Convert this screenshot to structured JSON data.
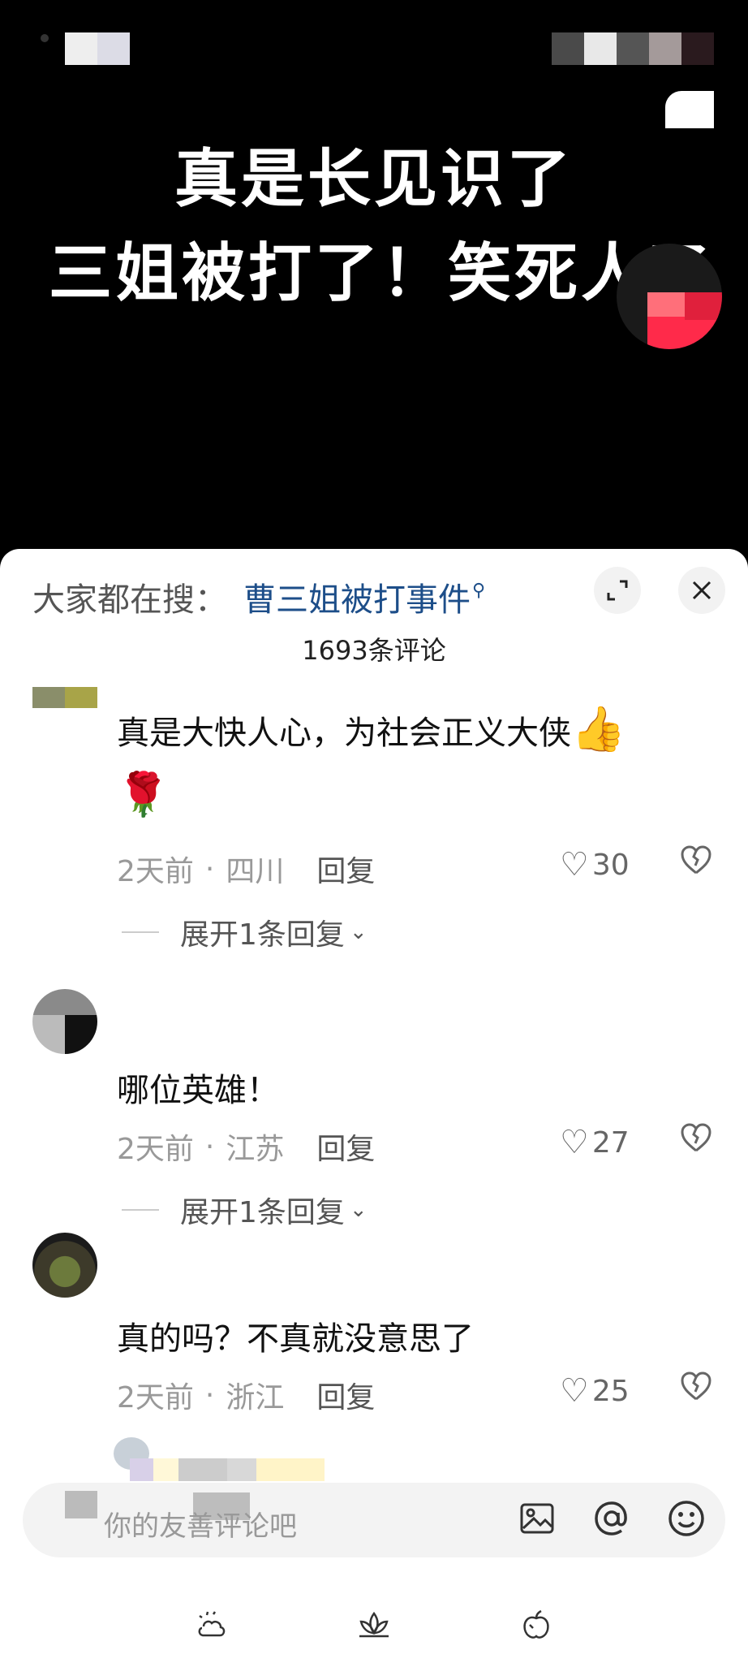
{
  "video": {
    "title_line1": "真是长见识了",
    "title_line2": "三姐被打了！笑死人了"
  },
  "sheet": {
    "search_prefix": "大家都在搜：",
    "search_query": "曹三姐被打事件",
    "comment_count": "1693条评论"
  },
  "comments": [
    {
      "text": "真是大快人心，为社会正义大侠",
      "emoji_thumb": "👍",
      "emoji_rose": "🌹",
      "time": "2天前",
      "location": "四川",
      "reply_label": "回复",
      "likes": "30",
      "expand_label": "展开1条回复"
    },
    {
      "text": "哪位英雄！",
      "time": "2天前",
      "location": "江苏",
      "reply_label": "回复",
      "likes": "27",
      "expand_label": "展开1条回复"
    },
    {
      "text": "真的吗？不真就没意思了",
      "time": "2天前",
      "location": "浙江",
      "reply_label": "回复",
      "likes": "25"
    }
  ],
  "input": {
    "placeholder": "你的友善评论吧"
  },
  "icons": {
    "expand": "expand-icon",
    "close": "close-icon",
    "heart": "heart-icon",
    "dislike": "broken-heart-icon",
    "image": "image-icon",
    "mention": "at-icon",
    "emoji": "smiley-icon"
  }
}
